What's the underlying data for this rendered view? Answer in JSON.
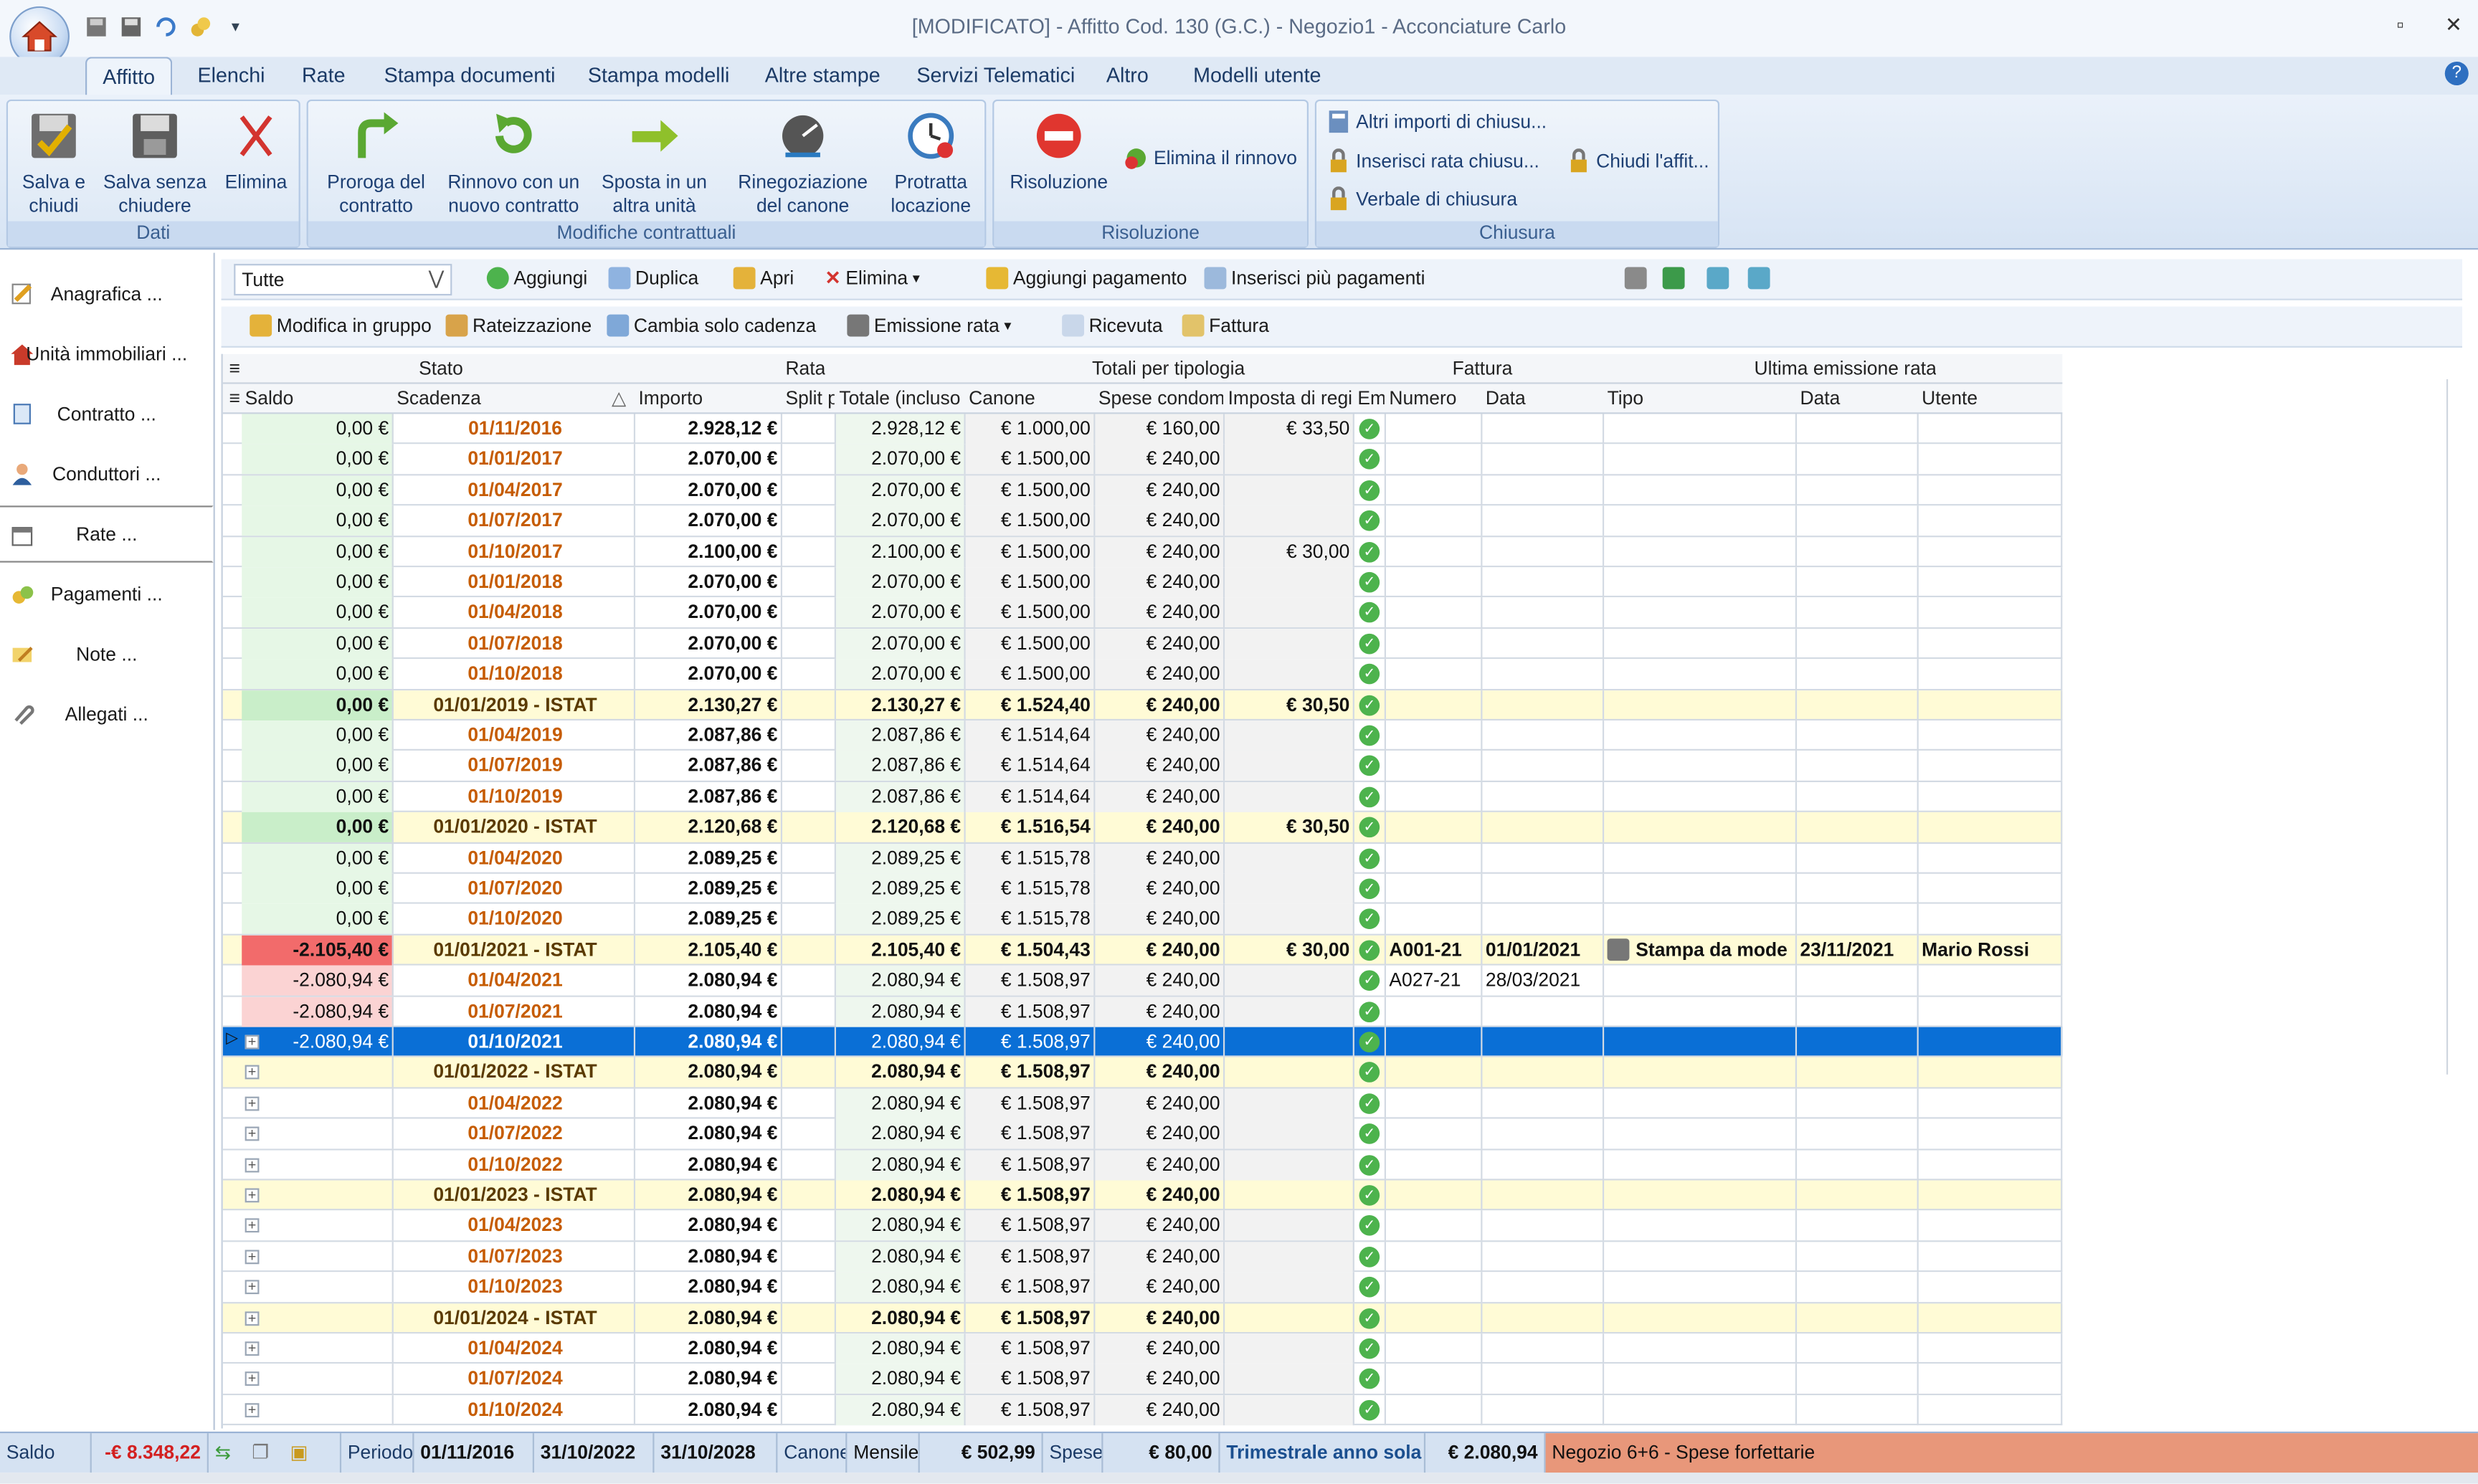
{
  "window": {
    "title": "[MODIFICATO] - Affitto Cod. 130 (G.C.) - Negozio1 - Acconciature Carlo",
    "minimize": "▫",
    "close": "✕"
  },
  "tabs": [
    "Affitto",
    "Elenchi",
    "Rate",
    "Stampa documenti",
    "Stampa modelli",
    "Altre stampe",
    "Servizi Telematici",
    "Altro",
    "Modelli utente"
  ],
  "ribbon": {
    "dati": {
      "label": "Dati",
      "save_close": [
        "Salva e",
        "chiudi"
      ],
      "save_no_close": [
        "Salva senza",
        "chiudere"
      ],
      "delete": [
        "Elimina"
      ]
    },
    "modifiche": {
      "label": "Modifiche contrattuali",
      "proroga": [
        "Proroga del",
        "contratto"
      ],
      "rinnovo": [
        "Rinnovo con un",
        "nuovo contratto"
      ],
      "sposta": [
        "Sposta in un",
        "altra unità"
      ],
      "rinegoziazione": [
        "Rinegoziazione",
        "del canone"
      ],
      "protratta": [
        "Protratta",
        "locazione"
      ]
    },
    "risoluzione": {
      "label": "Risoluzione",
      "risoluzione": [
        "Risoluzione"
      ],
      "elimina_rinnovo": "Elimina il rinnovo"
    },
    "chiusura": {
      "label": "Chiusura",
      "altri_importi": "Altri importi di chiusu...",
      "inserisci_rata": "Inserisci rata chiusu...",
      "verbale": "Verbale di chiusura",
      "chiudi_affitto": "Chiudi l'affit..."
    }
  },
  "sidebar": [
    {
      "label": "Anagrafica",
      "dots": "..."
    },
    {
      "label": "Unità immobiliari",
      "dots": "..."
    },
    {
      "label": "Contratto",
      "dots": "..."
    },
    {
      "label": "Conduttori",
      "dots": "..."
    },
    {
      "label": "Rate",
      "dots": "..."
    },
    {
      "label": "Pagamenti",
      "dots": "..."
    },
    {
      "label": "Note",
      "dots": "..."
    },
    {
      "label": "Allegati",
      "dots": "..."
    }
  ],
  "toolbar1": {
    "filter": "Tutte",
    "aggiungi": "Aggiungi",
    "duplica": "Duplica",
    "apri": "Apri",
    "elimina": "Elimina",
    "aggiungi_pagamento": "Aggiungi pagamento",
    "inserisci_pagamenti": "Inserisci più pagamenti"
  },
  "toolbar2": {
    "modifica_gruppo": "Modifica in gruppo",
    "rateizzazione": "Rateizzazione",
    "cambia_cadenza": "Cambia solo cadenza",
    "emissione_rata": "Emissione rata",
    "ricevuta": "Ricevuta",
    "fattura": "Fattura"
  },
  "grid": {
    "band_headers": [
      "Stato",
      "Rata",
      "Totali per tipologia",
      "Fattura",
      "Ultima emissione rata"
    ],
    "columns": [
      "Saldo",
      "Scadenza",
      "Importo",
      "Split p",
      "Totale (incluso b",
      "Canone",
      "Spese condomir",
      "Imposta di regis",
      "Em",
      "Numero",
      "Data",
      "Tipo",
      "Data",
      "Utente"
    ],
    "rows": [
      [
        "0,00 €",
        "01/11/2016",
        "2.928,12 €",
        "",
        "2.928,12 €",
        "€ 1.000,00",
        "€ 160,00",
        "€ 33,50",
        "",
        "",
        "",
        "",
        "",
        ""
      ],
      [
        "0,00 €",
        "01/01/2017",
        "2.070,00 €",
        "",
        "2.070,00 €",
        "€ 1.500,00",
        "€ 240,00",
        "",
        "",
        "",
        "",
        "",
        "",
        ""
      ],
      [
        "0,00 €",
        "01/04/2017",
        "2.070,00 €",
        "",
        "2.070,00 €",
        "€ 1.500,00",
        "€ 240,00",
        "",
        "",
        "",
        "",
        "",
        "",
        ""
      ],
      [
        "0,00 €",
        "01/07/2017",
        "2.070,00 €",
        "",
        "2.070,00 €",
        "€ 1.500,00",
        "€ 240,00",
        "",
        "",
        "",
        "",
        "",
        "",
        ""
      ],
      [
        "0,00 €",
        "01/10/2017",
        "2.100,00 €",
        "",
        "2.100,00 €",
        "€ 1.500,00",
        "€ 240,00",
        "€ 30,00",
        "",
        "",
        "",
        "",
        "",
        ""
      ],
      [
        "0,00 €",
        "01/01/2018",
        "2.070,00 €",
        "",
        "2.070,00 €",
        "€ 1.500,00",
        "€ 240,00",
        "",
        "",
        "",
        "",
        "",
        "",
        ""
      ],
      [
        "0,00 €",
        "01/04/2018",
        "2.070,00 €",
        "",
        "2.070,00 €",
        "€ 1.500,00",
        "€ 240,00",
        "",
        "",
        "",
        "",
        "",
        "",
        ""
      ],
      [
        "0,00 €",
        "01/07/2018",
        "2.070,00 €",
        "",
        "2.070,00 €",
        "€ 1.500,00",
        "€ 240,00",
        "",
        "",
        "",
        "",
        "",
        "",
        ""
      ],
      [
        "0,00 €",
        "01/10/2018",
        "2.070,00 €",
        "",
        "2.070,00 €",
        "€ 1.500,00",
        "€ 240,00",
        "",
        "",
        "",
        "",
        "",
        "",
        ""
      ],
      [
        "0,00 €",
        "01/01/2019 - ISTAT",
        "2.130,27 €",
        "",
        "2.130,27 €",
        "€ 1.524,40",
        "€ 240,00",
        "€ 30,50",
        "",
        "",
        "",
        "",
        "",
        ""
      ],
      [
        "0,00 €",
        "01/04/2019",
        "2.087,86 €",
        "",
        "2.087,86 €",
        "€ 1.514,64",
        "€ 240,00",
        "",
        "",
        "",
        "",
        "",
        "",
        ""
      ],
      [
        "0,00 €",
        "01/07/2019",
        "2.087,86 €",
        "",
        "2.087,86 €",
        "€ 1.514,64",
        "€ 240,00",
        "",
        "",
        "",
        "",
        "",
        "",
        ""
      ],
      [
        "0,00 €",
        "01/10/2019",
        "2.087,86 €",
        "",
        "2.087,86 €",
        "€ 1.514,64",
        "€ 240,00",
        "",
        "",
        "",
        "",
        "",
        "",
        ""
      ],
      [
        "0,00 €",
        "01/01/2020 - ISTAT",
        "2.120,68 €",
        "",
        "2.120,68 €",
        "€ 1.516,54",
        "€ 240,00",
        "€ 30,50",
        "",
        "",
        "",
        "",
        "",
        ""
      ],
      [
        "0,00 €",
        "01/04/2020",
        "2.089,25 €",
        "",
        "2.089,25 €",
        "€ 1.515,78",
        "€ 240,00",
        "",
        "",
        "",
        "",
        "",
        "",
        ""
      ],
      [
        "0,00 €",
        "01/07/2020",
        "2.089,25 €",
        "",
        "2.089,25 €",
        "€ 1.515,78",
        "€ 240,00",
        "",
        "",
        "",
        "",
        "",
        "",
        ""
      ],
      [
        "0,00 €",
        "01/10/2020",
        "2.089,25 €",
        "",
        "2.089,25 €",
        "€ 1.515,78",
        "€ 240,00",
        "",
        "",
        "",
        "",
        "",
        "",
        ""
      ],
      [
        "-2.105,40 €",
        "01/01/2021 - ISTAT",
        "2.105,40 €",
        "",
        "2.105,40 €",
        "€ 1.504,43",
        "€ 240,00",
        "€ 30,00",
        "",
        "A001-21",
        "01/01/2021",
        "Stampa da mode",
        "23/11/2021",
        "Mario Rossi"
      ],
      [
        "-2.080,94 €",
        "01/04/2021",
        "2.080,94 €",
        "",
        "2.080,94 €",
        "€ 1.508,97",
        "€ 240,00",
        "",
        "",
        "A027-21",
        "28/03/2021",
        "",
        "",
        ""
      ],
      [
        "-2.080,94 €",
        "01/07/2021",
        "2.080,94 €",
        "",
        "2.080,94 €",
        "€ 1.508,97",
        "€ 240,00",
        "",
        "",
        "",
        "",
        "",
        "",
        ""
      ],
      [
        "-2.080,94 €",
        "01/10/2021",
        "2.080,94 €",
        "",
        "2.080,94 €",
        "€ 1.508,97",
        "€ 240,00",
        "",
        "",
        "",
        "",
        "",
        "",
        ""
      ],
      [
        "",
        "01/01/2022 - ISTAT",
        "2.080,94 €",
        "",
        "2.080,94 €",
        "€ 1.508,97",
        "€ 240,00",
        "",
        "",
        "",
        "",
        "",
        "",
        ""
      ],
      [
        "",
        "01/04/2022",
        "2.080,94 €",
        "",
        "2.080,94 €",
        "€ 1.508,97",
        "€ 240,00",
        "",
        "",
        "",
        "",
        "",
        "",
        ""
      ],
      [
        "",
        "01/07/2022",
        "2.080,94 €",
        "",
        "2.080,94 €",
        "€ 1.508,97",
        "€ 240,00",
        "",
        "",
        "",
        "",
        "",
        "",
        ""
      ],
      [
        "",
        "01/10/2022",
        "2.080,94 €",
        "",
        "2.080,94 €",
        "€ 1.508,97",
        "€ 240,00",
        "",
        "",
        "",
        "",
        "",
        "",
        ""
      ],
      [
        "",
        "01/01/2023 - ISTAT",
        "2.080,94 €",
        "",
        "2.080,94 €",
        "€ 1.508,97",
        "€ 240,00",
        "",
        "",
        "",
        "",
        "",
        "",
        ""
      ],
      [
        "",
        "01/04/2023",
        "2.080,94 €",
        "",
        "2.080,94 €",
        "€ 1.508,97",
        "€ 240,00",
        "",
        "",
        "",
        "",
        "",
        "",
        ""
      ],
      [
        "",
        "01/07/2023",
        "2.080,94 €",
        "",
        "2.080,94 €",
        "€ 1.508,97",
        "€ 240,00",
        "",
        "",
        "",
        "",
        "",
        "",
        ""
      ],
      [
        "",
        "01/10/2023",
        "2.080,94 €",
        "",
        "2.080,94 €",
        "€ 1.508,97",
        "€ 240,00",
        "",
        "",
        "",
        "",
        "",
        "",
        ""
      ],
      [
        "",
        "01/01/2024 - ISTAT",
        "2.080,94 €",
        "",
        "2.080,94 €",
        "€ 1.508,97",
        "€ 240,00",
        "",
        "",
        "",
        "",
        "",
        "",
        ""
      ],
      [
        "",
        "01/04/2024",
        "2.080,94 €",
        "",
        "2.080,94 €",
        "€ 1.508,97",
        "€ 240,00",
        "",
        "",
        "",
        "",
        "",
        "",
        ""
      ],
      [
        "",
        "01/07/2024",
        "2.080,94 €",
        "",
        "2.080,94 €",
        "€ 1.508,97",
        "€ 240,00",
        "",
        "",
        "",
        "",
        "",
        "",
        ""
      ],
      [
        "",
        "01/10/2024",
        "2.080,94 €",
        "",
        "2.080,94 €",
        "€ 1.508,97",
        "€ 240,00",
        "",
        "",
        "",
        "",
        "",
        "",
        ""
      ]
    ],
    "istat_rows": [
      9,
      13,
      17,
      21,
      25,
      29
    ],
    "selected_row": 20,
    "negative_rows": [
      17,
      18,
      19,
      20
    ]
  },
  "statusbar": {
    "saldo_label": "Saldo",
    "saldo_value": "-€ 8.348,22",
    "periodo_label": "Periodo",
    "periodo_start": "01/11/2016",
    "periodo_end": "31/10/2022",
    "periodo_end2": "31/10/2028",
    "canone_label": "Canone",
    "cadenza": "Mensile",
    "canone_value": "€ 502,99",
    "spese_label": "Spese",
    "spese_value": "€ 80,00",
    "trimestrale": "Trimestrale anno sola",
    "trimestrale_value": "€ 2.080,94",
    "negozio": "Negozio 6+6 - Spese forfettarie"
  },
  "colors": {
    "accent": "#0a6fd6",
    "istat_row": "#fffbd6",
    "negative": "#f26b6b",
    "status_orange": "#e8977a",
    "date_orange": "#c65c00"
  }
}
